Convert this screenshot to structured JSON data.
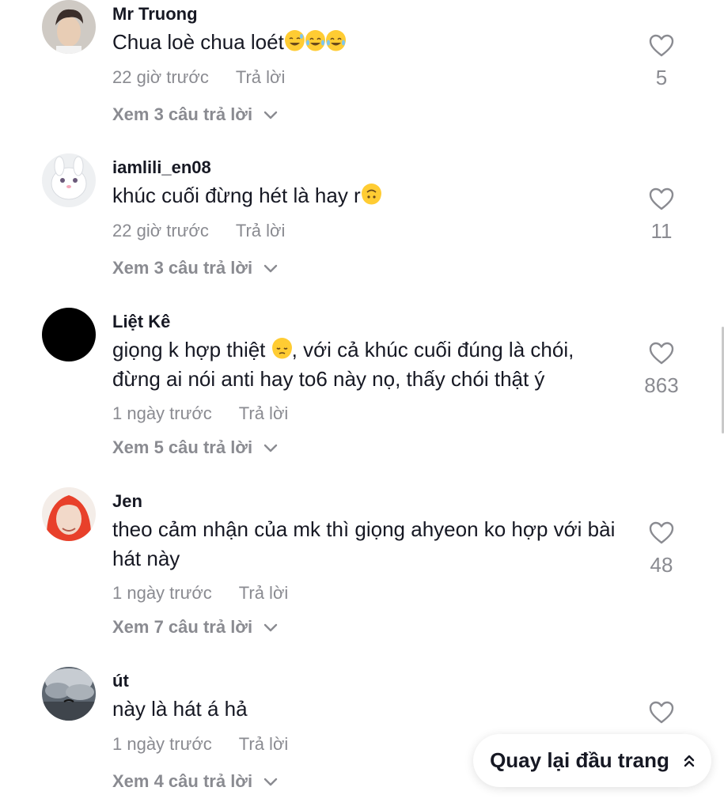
{
  "comments": [
    {
      "username": "Mr Truong",
      "text": "Chua loè chua loét",
      "time": "22 giờ trước",
      "reply": "Trả lời",
      "view_replies": "Xem 3 câu trả lời",
      "likes": "5",
      "avatar": "photo-portrait",
      "emojis": [
        "grinning-sweat",
        "joy",
        "joy"
      ]
    },
    {
      "username": "iamlili_en08",
      "text": "khúc cuối đừng hét là hay r",
      "time": "22 giờ trước",
      "reply": "Trả lời",
      "view_replies": "Xem 3 câu trả lời",
      "likes": "11",
      "avatar": "white-rabbit",
      "emojis": [
        "upside-down"
      ]
    },
    {
      "username": "Liệt Kê",
      "text_before": "giọng k hợp thiệt ",
      "text_after": ", với cả khúc cuối đúng là chói, đừng ai nói anti hay to6 này nọ, thấy chói thật ý",
      "time": "1 ngày trước",
      "reply": "Trả lời",
      "view_replies": "Xem 5 câu trả lời",
      "likes": "863",
      "avatar": "black-circle",
      "emojis": [
        "pensive"
      ]
    },
    {
      "username": "Jen",
      "text": "theo cảm nhận của mk thì giọng ahyeon ko hợp với bài hát này",
      "time": "1 ngày trước",
      "reply": "Trả lời",
      "view_replies": "Xem 7 câu trả lời",
      "likes": "48",
      "avatar": "red-hair-portrait"
    },
    {
      "username": "út",
      "text": "này là hát á hả",
      "time": "1 ngày trước",
      "reply": "Trả lời",
      "view_replies": "Xem 4 câu trả lời",
      "likes": "",
      "avatar": "cloudy-sky"
    }
  ],
  "back_to_top": {
    "label": "Quay lại đầu trang"
  },
  "colors": {
    "text": "#161823",
    "muted": "#8a8b91",
    "emoji": "#ffcc33"
  }
}
